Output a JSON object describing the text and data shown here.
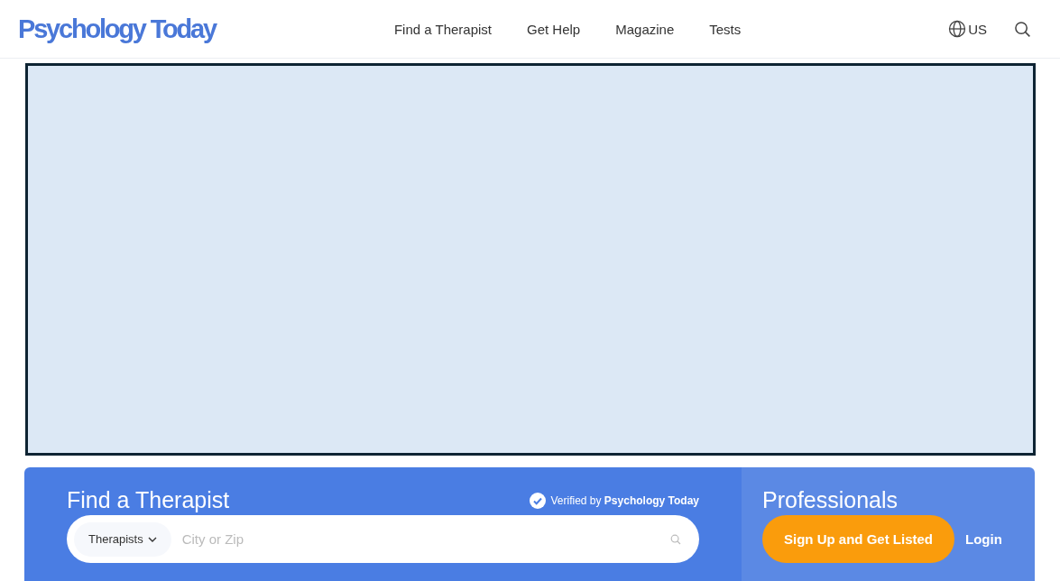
{
  "header": {
    "logo": "Psychology Today",
    "nav": [
      "Find a Therapist",
      "Get Help",
      "Magazine",
      "Tests"
    ],
    "region": "US"
  },
  "search_panel": {
    "title": "Find a Therapist",
    "verified": "Verified by **Psychology Today**",
    "type_select": "Therapists",
    "placeholder": "City or Zip"
  },
  "professionals": {
    "title": "Professionals",
    "signup": "Sign Up and Get Listed",
    "login": "Login"
  }
}
